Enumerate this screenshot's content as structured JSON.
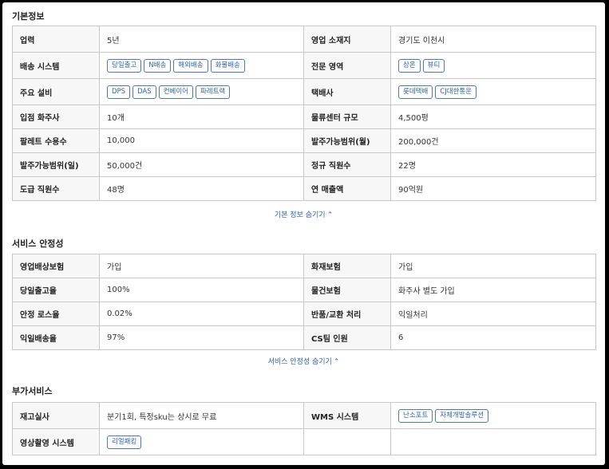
{
  "basic": {
    "title": "기본정보",
    "rows": [
      {
        "l1": "업력",
        "v1": "5년",
        "l2": "영업 소재지",
        "v2": "경기도 이천시"
      },
      {
        "l1": "배송 시스템",
        "tags1": [
          "당일출고",
          "N배송",
          "해외배송",
          "화물배송"
        ],
        "l2": "전문 영역",
        "tags2": [
          "상온",
          "뷰티"
        ]
      },
      {
        "l1": "주요 설비",
        "tags1": [
          "DPS",
          "DAS",
          "컨베이어",
          "파레트랙"
        ],
        "l2": "택배사",
        "tags2": [
          "롯데택배",
          "CJ대한통운"
        ]
      },
      {
        "l1": "입점 화주사",
        "v1": "10개",
        "l2": "물류센터 규모",
        "v2": "4,500평"
      },
      {
        "l1": "팔레트 수용수",
        "v1": "10,000",
        "l2": "발주가능범위(월)",
        "v2": "200,000건"
      },
      {
        "l1": "발주가능범위(일)",
        "v1": "50,000건",
        "l2": "정규 직원수",
        "v2": "22명"
      },
      {
        "l1": "도급 직원수",
        "v1": "48명",
        "l2": "연 매출액",
        "v2": "90억원"
      }
    ],
    "toggle_label": "기본 정보 숨기기"
  },
  "stability": {
    "title": "서비스 안정성",
    "rows": [
      {
        "l1": "영업배상보험",
        "v1": "가입",
        "l2": "화재보험",
        "v2": "가입"
      },
      {
        "l1": "당일출고율",
        "v1": "100%",
        "l2": "물건보험",
        "v2": "화주사 별도 가입"
      },
      {
        "l1": "안정 로스율",
        "v1": "0.02%",
        "l2": "반품/교환 처리",
        "v2": "익일처리"
      },
      {
        "l1": "익일배송율",
        "v1": "97%",
        "l2": "CS팀 인원",
        "v2": "6"
      }
    ],
    "toggle_label": "서비스 안정성 숨기기"
  },
  "extra": {
    "title": "부가서비스",
    "rows": [
      {
        "l1": "재고실사",
        "v1": "분기1회, 특정sku는 상시로 무료",
        "l2": "WMS 시스템",
        "tags2": [
          "난소포트",
          "자체개발솔루션"
        ]
      },
      {
        "l1": "영상촬영 시스템",
        "tags1": [
          "리얼패킹"
        ],
        "l2": "",
        "v2": ""
      }
    ]
  },
  "icons": {
    "toggle_chevron": "chevron-up-icon"
  },
  "colors": {
    "accent": "#2d63b0",
    "label_bg": "#f7f7f7",
    "border": "#c8c8c8"
  }
}
